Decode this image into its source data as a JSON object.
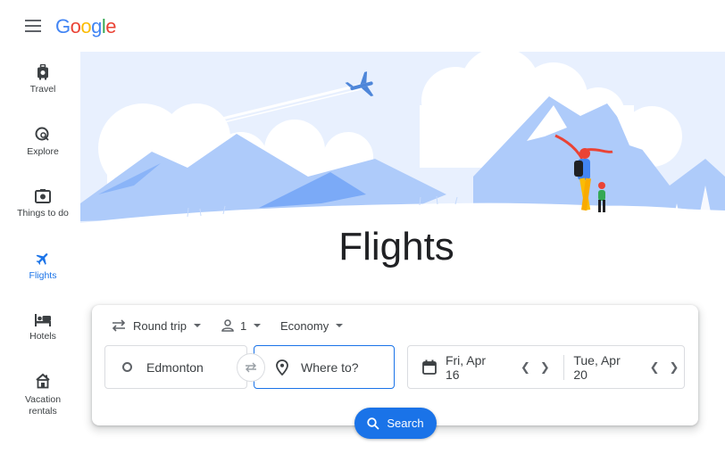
{
  "header": {
    "logo_letters": [
      {
        "ch": "G",
        "color": "#4285f4"
      },
      {
        "ch": "o",
        "color": "#ea4335"
      },
      {
        "ch": "o",
        "color": "#fbbc05"
      },
      {
        "ch": "g",
        "color": "#4285f4"
      },
      {
        "ch": "l",
        "color": "#34a853"
      },
      {
        "ch": "e",
        "color": "#ea4335"
      }
    ]
  },
  "sidebar": {
    "items": [
      {
        "label": "Travel",
        "icon": "luggage-icon",
        "active": false
      },
      {
        "label": "Explore",
        "icon": "explore-icon",
        "active": false
      },
      {
        "label": "Things to do",
        "icon": "camera-icon",
        "active": false
      },
      {
        "label": "Flights",
        "icon": "airplane-icon",
        "active": true
      },
      {
        "label": "Hotels",
        "icon": "bed-icon",
        "active": false
      },
      {
        "label": "Vacation rentals",
        "label_line1": "Vacation",
        "label_line2": "rentals",
        "icon": "house-icon",
        "active": false
      }
    ]
  },
  "main": {
    "title": "Flights"
  },
  "search_form": {
    "trip_type": "Round trip",
    "passengers": "1",
    "cabin_class": "Economy",
    "origin": "Edmonton",
    "destination_placeholder": "Where to?",
    "depart_date": "Fri, Apr 16",
    "return_date": "Tue, Apr 20",
    "search_label": "Search"
  },
  "colors": {
    "accent": "#1a73e8",
    "hero_sky": "#e8f0fe",
    "hero_mountain": "#aecbfa"
  }
}
